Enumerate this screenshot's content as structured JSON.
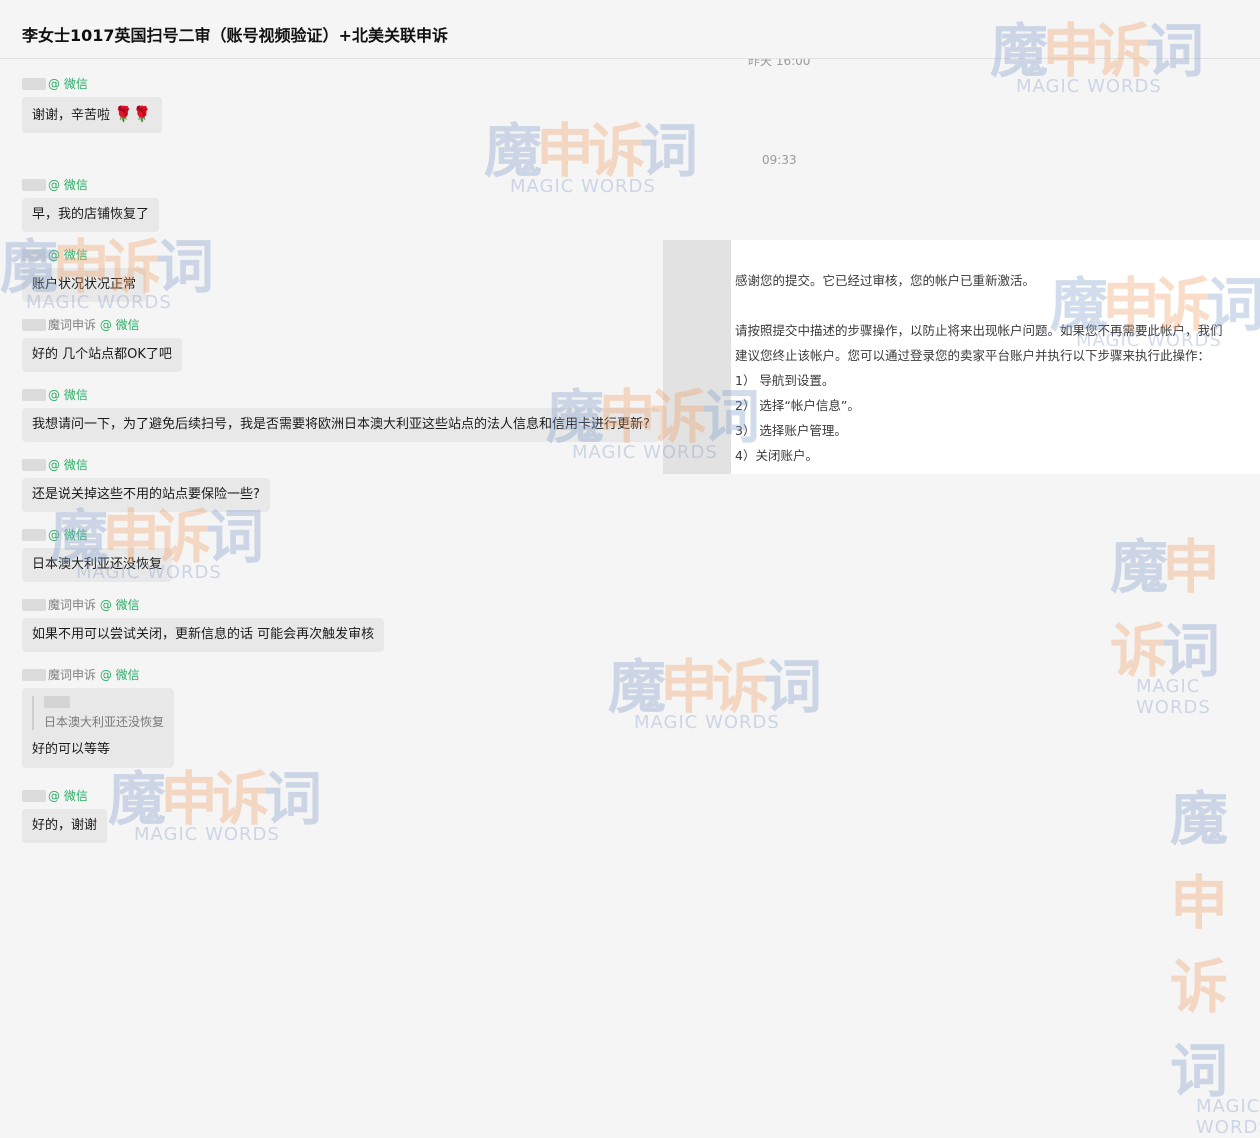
{
  "header": {
    "title": "李女士1017英国扫号二审（账号视频验证）+北美关联申诉"
  },
  "timestamps": {
    "yesterday": "昨天 16:00",
    "morning": "09:33"
  },
  "messages": [
    {
      "sender": "@ 微信",
      "text": "谢谢，辛苦啦"
    },
    {
      "sender": "@ 微信",
      "text": "早，我的店铺恢复了"
    },
    {
      "sender": "@ 微信",
      "text": "账户状况状况正常"
    },
    {
      "sender_name": "魔词申诉",
      "sender_wx": "@ 微信",
      "text": "好的 几个站点都OK了吧"
    },
    {
      "sender": "@ 微信",
      "text": "我想请问一下，为了避免后续扫号，我是否需要将欧洲日本澳大利亚这些站点的法人信息和信用卡进行更新?"
    },
    {
      "sender": "@ 微信",
      "text": "还是说关掉这些不用的站点要保险一些?"
    },
    {
      "sender": "@ 微信",
      "text": "日本澳大利亚还没恢复"
    },
    {
      "sender_name": "魔词申诉",
      "sender_wx": "@ 微信",
      "text": "如果不用可以尝试关闭，更新信息的话 可能会再次触发审核"
    },
    {
      "sender_name": "魔词申诉",
      "sender_wx": "@ 微信",
      "quote": "日本澳大利亚还没恢复",
      "text": "好的可以等等"
    },
    {
      "sender": "@ 微信",
      "text": "好的，谢谢"
    }
  ],
  "image_card": {
    "lines": [
      "感谢您的提交。它已经过审核，您的帐户已重新激活。",
      "",
      "请按照提交中描述的步骤操作，以防止将来出现帐户问题。如果您不再需要此帐户，我们",
      "建议您终止该帐户。您可以通过登录您的卖家平台账户并执行以下步骤来执行此操作：",
      "1）  导航到设置。",
      "2）  选择“帐户信息”。",
      "3）  选择账户管理。",
      "4）关闭账户。"
    ]
  },
  "watermark": {
    "cn_1": "魔",
    "cn_2": "申诉",
    "cn_3": "词",
    "en": "MAGIC WORDS"
  },
  "colors": {
    "wechat_green": "#2aae67",
    "bubble": "#e8e8e8",
    "background": "#f5f5f5"
  }
}
